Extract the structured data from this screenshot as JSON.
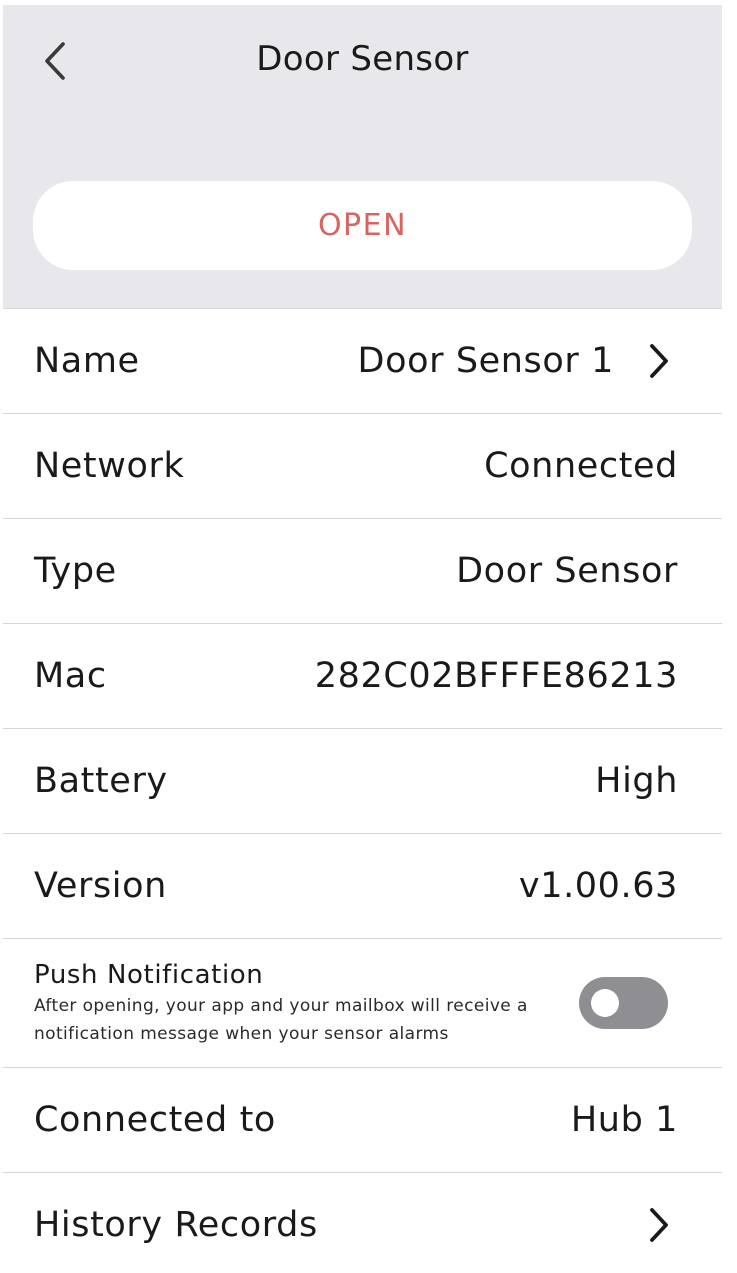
{
  "header": {
    "title": "Door Sensor",
    "status": "OPEN"
  },
  "rows": {
    "name": {
      "label": "Name",
      "value": "Door Sensor 1"
    },
    "network": {
      "label": "Network",
      "value": "Connected"
    },
    "type": {
      "label": "Type",
      "value": "Door Sensor"
    },
    "mac": {
      "label": "Mac",
      "value": "282C02BFFFE86213"
    },
    "battery": {
      "label": "Battery",
      "value": "High"
    },
    "version": {
      "label": "Version",
      "value": "v1.00.63"
    },
    "push": {
      "title": "Push Notification",
      "description": "After opening, your app  and your mailbox will receive a notification message when your sensor alarms",
      "enabled": false
    },
    "connected_to": {
      "label": "Connected to",
      "value": "Hub 1"
    },
    "history": {
      "label": "History Records"
    }
  },
  "icons": {
    "back": "chevron-left-icon",
    "chevron": "chevron-right-icon"
  },
  "colors": {
    "header_bg": "#e7e7ec",
    "status_text": "#d9645f",
    "divider": "#d6d6d6",
    "toggle_off": "#8e8e93"
  }
}
